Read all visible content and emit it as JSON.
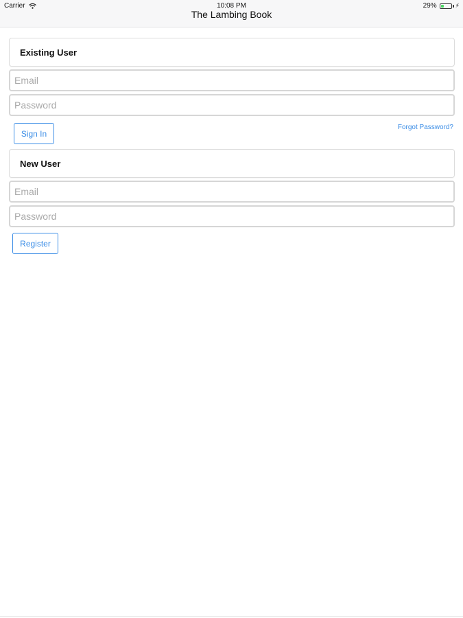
{
  "status_bar": {
    "carrier": "Carrier",
    "time": "10:08 PM",
    "battery": "29%",
    "battery_level": 0.29,
    "wifi_icon": "wifi-icon",
    "charging_icon": "bolt-icon"
  },
  "nav": {
    "title": "The Lambing Book"
  },
  "existing_user": {
    "header": "Existing User",
    "email_placeholder": "Email",
    "password_placeholder": "Password",
    "sign_in_label": "Sign In",
    "forgot_password_label": "Forgot Password?"
  },
  "new_user": {
    "header": "New User",
    "email_placeholder": "Email",
    "password_placeholder": "Password",
    "register_label": "Register"
  },
  "colors": {
    "accent": "#3b8de6",
    "battery_green": "#4cd964",
    "border": "#d6d6d6"
  }
}
